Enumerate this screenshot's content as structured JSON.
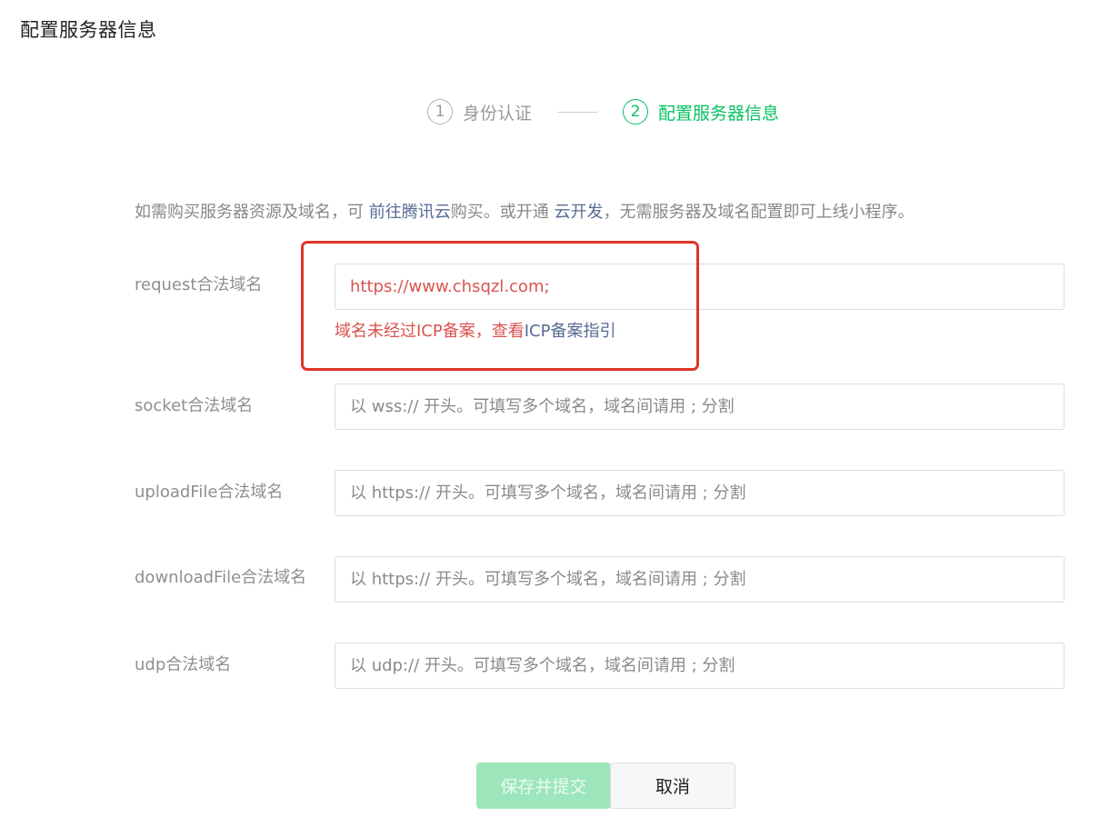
{
  "page": {
    "title": "配置服务器信息"
  },
  "steps": [
    {
      "num": "1",
      "label": "身份认证",
      "active": false
    },
    {
      "num": "2",
      "label": "配置服务器信息",
      "active": true
    }
  ],
  "intro": {
    "prefix": "如需购买服务器资源及域名，可 ",
    "link1": "前往腾讯云",
    "mid": "购买。或开通 ",
    "link2": "云开发",
    "suffix": "，无需服务器及域名配置即可上线小程序。"
  },
  "form": {
    "request": {
      "label": "request合法域名",
      "value": "https://www.chsqzl.com;",
      "error_text": "域名未经过ICP备案，查看",
      "error_link": "ICP备案指引"
    },
    "socket": {
      "label": "socket合法域名",
      "placeholder": "以 wss:// 开头。可填写多个域名，域名间请用 ; 分割"
    },
    "uploadFile": {
      "label": "uploadFile合法域名",
      "placeholder": "以 https:// 开头。可填写多个域名，域名间请用 ; 分割"
    },
    "downloadFile": {
      "label": "downloadFile合法域名",
      "placeholder": "以 https:// 开头。可填写多个域名，域名间请用 ; 分割"
    },
    "udp": {
      "label": "udp合法域名",
      "placeholder": "以 udp:// 开头。可填写多个域名，域名间请用 ; 分割"
    }
  },
  "buttons": {
    "submit": "保存并提交",
    "cancel": "取消"
  },
  "colors": {
    "accent": "#07c160",
    "error": "#d9534f",
    "link": "#576b95",
    "highlight": "#e0342a"
  }
}
